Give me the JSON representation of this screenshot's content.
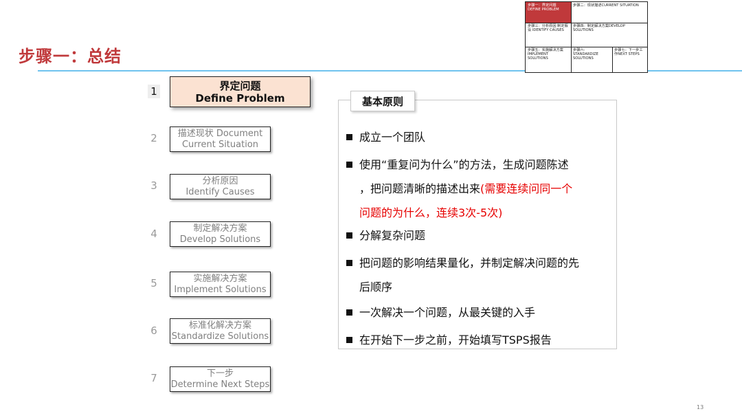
{
  "title": "步骤一：总结",
  "mini_grid": {
    "cells": [
      "步骤一：界定问题 DEFINE PROBLEM",
      "步骤二：现状描述CURRENT SITUATION",
      "步骤三：分析原因 制定假设 IDENTIFY CAUSES",
      "步骤四：制定解决方案DEVELOP SOLUTIONS",
      "步骤五：实施解决方案IMPLEMENT SOLUTIONS",
      "步骤六: STANDARDIZE SOLUTIONS",
      "步骤七：下一步工作NEXT STEPS"
    ],
    "active_color": "#c0393b"
  },
  "steps": [
    {
      "num": "1",
      "zh": "界定问题",
      "en": "Define Problem",
      "active": true
    },
    {
      "num": "2",
      "zh": "描述现状 Document",
      "en": "Current Situation"
    },
    {
      "num": "3",
      "zh": "分析原因",
      "en": "Identify Causes"
    },
    {
      "num": "4",
      "zh": "制定解决方案",
      "en": "Develop Solutions"
    },
    {
      "num": "5",
      "zh": "实施解决方案",
      "en": "Implement Solutions"
    },
    {
      "num": "6",
      "zh": "标准化解决方案",
      "en": "Standardize Solutions"
    },
    {
      "num": "7",
      "zh": "下一步",
      "en": "Determine Next Steps"
    }
  ],
  "principles": {
    "heading": "基本原则",
    "items": [
      {
        "lines": [
          "成立一个团队"
        ]
      },
      {
        "lines": [
          "使用“重复问为什么”的方法，生成问题陈述",
          "，把问题清晰的描述出来"
        ],
        "red": [
          "(需要连续问同一个",
          "问题的为什么，连续3次-5次)"
        ]
      },
      {
        "lines": [
          "分解复杂问题"
        ]
      },
      {
        "lines": [
          "把问题的影响结果量化，并制定解决问题的先",
          "后顺序"
        ]
      },
      {
        "lines": [
          "一次解决一个问题，从最关键的入手"
        ]
      },
      {
        "lines": [
          "在开始下一步之前，开始填写TSPS报告"
        ]
      }
    ]
  },
  "page_number": "13"
}
